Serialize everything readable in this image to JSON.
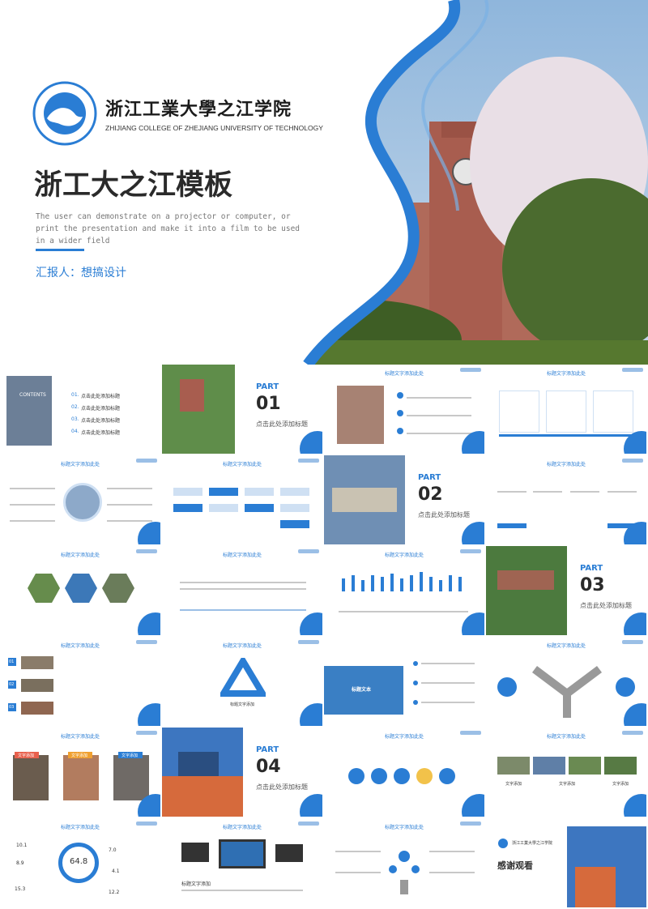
{
  "cover": {
    "logo_cn": "浙江工業大學之江学院",
    "logo_en": "ZHIJIANG COLLEGE OF ZHEJIANG UNIVERSITY OF TECHNOLOGY",
    "title": "浙工大之江模板",
    "subtitle": "The user can demonstrate on a projector or computer, or print the presentation and make it into a film to be used in a wider field",
    "reporter": "汇报人：想搞设计"
  },
  "slides": {
    "title_placeholder": "标题文字添加此处",
    "contents_label": "CONTENTS",
    "contents_items": [
      "点击此处添加标题",
      "点击此处添加标题",
      "点击此处添加标题",
      "点击此处添加标题"
    ],
    "contents_nums": [
      "01.",
      "02.",
      "03.",
      "04."
    ],
    "part_label": "PART",
    "part_subtitle": "点击此处添加标题",
    "parts": [
      "01",
      "02",
      "03",
      "04"
    ],
    "label_text": "标题文本",
    "thanks": "感谢观看",
    "gauge_value": "64.8",
    "text_add": "文字添加",
    "title_add": "标题文字添加",
    "side_nums": [
      "10.1",
      "8.9",
      "15.3",
      "7.0",
      "4.1",
      "12.2"
    ],
    "row_nums": [
      "01",
      "02",
      "03"
    ]
  },
  "colors": {
    "accent": "#2a7dd4",
    "dark": "#2a2a2a",
    "light_blue": "#9bbfe6"
  }
}
